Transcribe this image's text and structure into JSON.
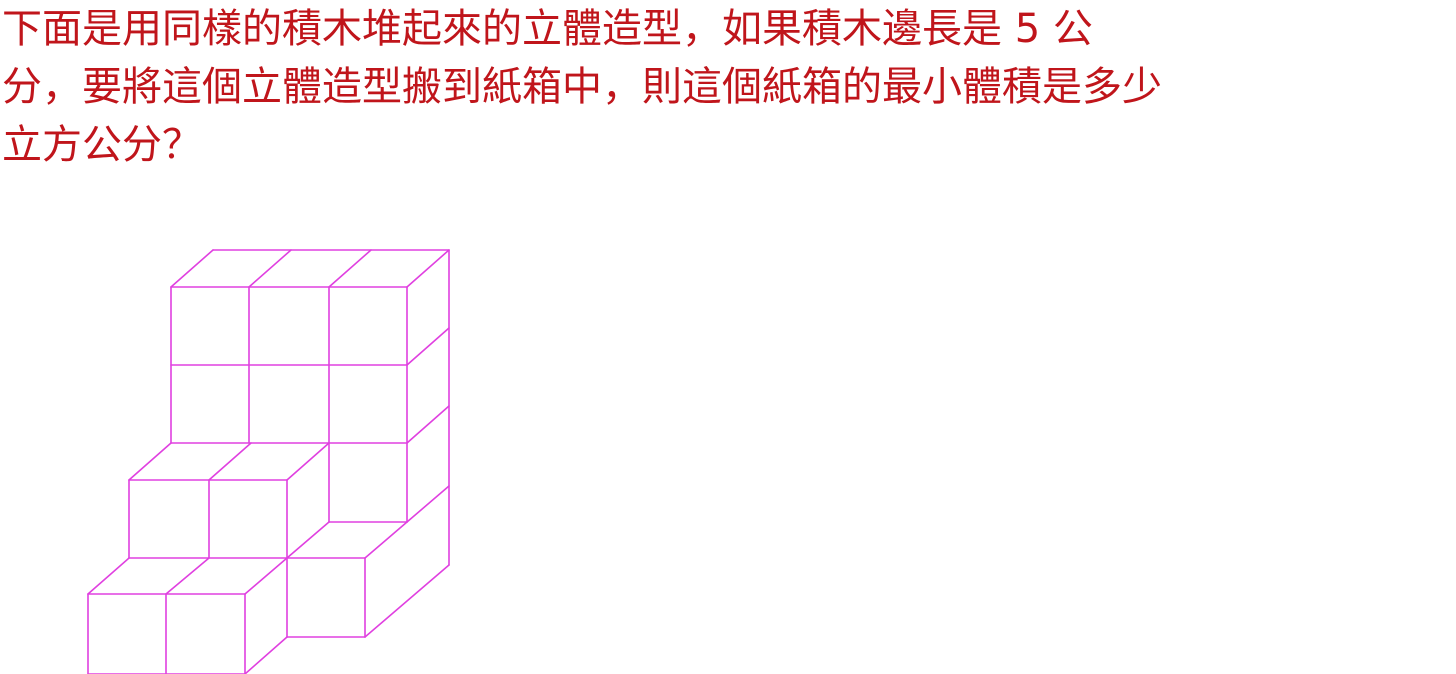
{
  "question": {
    "line1": "下面是用同樣的積木堆起來的立體造型，如果積木邊長是 5 公",
    "line2": "分，要將這個立體造型搬到紙箱中，則這個紙箱的最小體積是多少",
    "line3": "立方公分？"
  },
  "figure": {
    "type": "isometric block stack",
    "stroke_color": "#e040e0"
  },
  "colors": {
    "text": "#c0151b",
    "line": "#e040e0",
    "background": "#ffffff"
  }
}
